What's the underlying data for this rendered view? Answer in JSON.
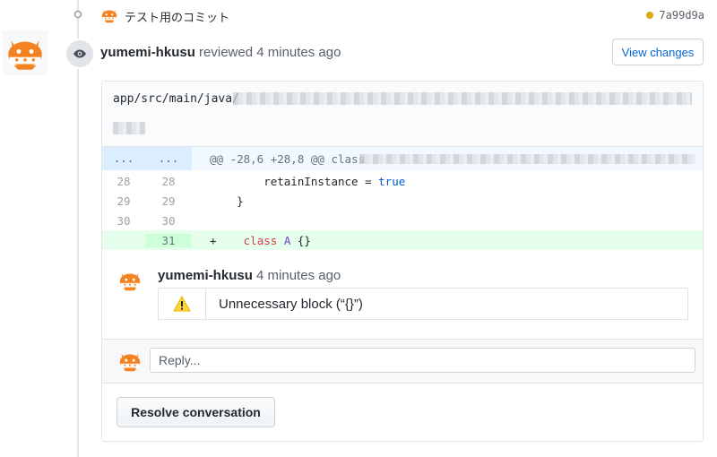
{
  "commit": {
    "message": "テスト用のコミット",
    "sha": "7a99d9a",
    "status_color": "#dbab09"
  },
  "review": {
    "author": "yumemi-hkusu",
    "action_text": "reviewed 4 minutes ago",
    "view_changes_label": "View changes"
  },
  "file": {
    "path_prefix": "app/src/main/java/"
  },
  "diff": {
    "hunk_left": "...",
    "hunk_right": "...",
    "hunk_header": "@@ -28,6 +28,8 @@ class",
    "lines": [
      {
        "old": "28",
        "new": "28",
        "marker": "",
        "code": "        retainInstance = true",
        "type": "context"
      },
      {
        "old": "29",
        "new": "29",
        "marker": "",
        "code": "    }",
        "type": "context"
      },
      {
        "old": "30",
        "new": "30",
        "marker": "",
        "code": "",
        "type": "context"
      },
      {
        "old": "",
        "new": "31",
        "marker": "+",
        "code": "    class A {}",
        "type": "add"
      }
    ]
  },
  "comment": {
    "author": "yumemi-hkusu",
    "time": "4 minutes ago",
    "warning_icon": "warning-icon",
    "message": "Unnecessary block (“{}”)"
  },
  "reply": {
    "placeholder": "Reply..."
  },
  "resolve_label": "Resolve conversation",
  "icons": {
    "commit": "git-commit-icon",
    "eye": "eye-icon",
    "avatar": "orange-mascot-avatar"
  },
  "colors": {
    "link": "#0366d6",
    "addition_bg": "#e6ffed",
    "hunk_bg": "#f1f8ff",
    "avatar_orange": "#f58220"
  }
}
